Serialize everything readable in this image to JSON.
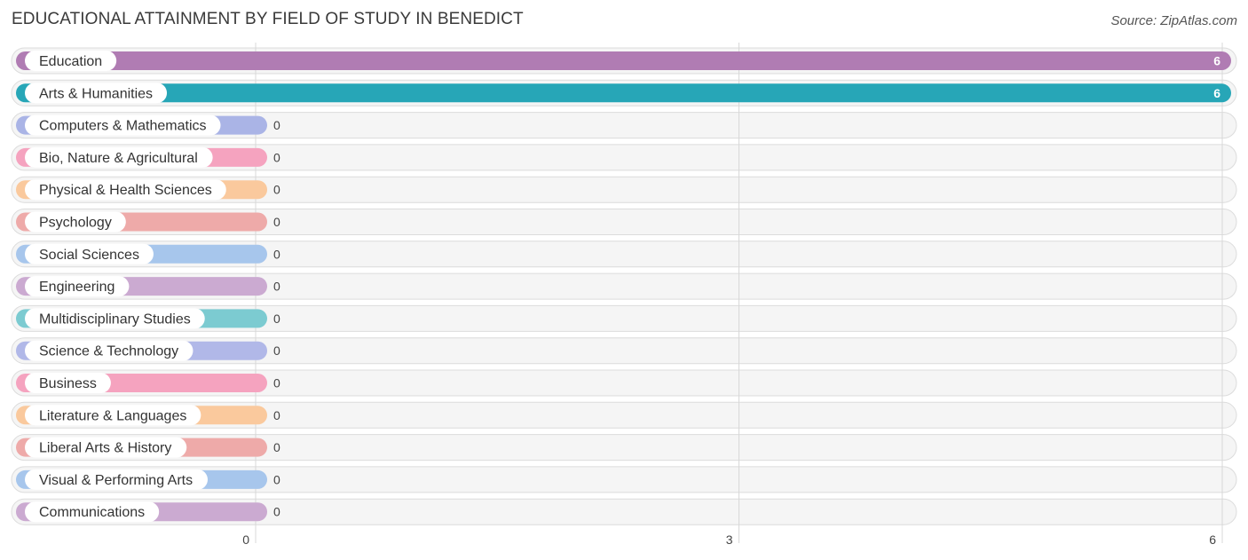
{
  "chart_data": {
    "type": "bar",
    "orientation": "horizontal",
    "title": "EDUCATIONAL ATTAINMENT BY FIELD OF STUDY IN BENEDICT",
    "source": "Source: ZipAtlas.com",
    "xlabel": "",
    "ylabel": "",
    "xlim": [
      0,
      6
    ],
    "xticks": [
      0,
      3,
      6
    ],
    "grid": true,
    "categories": [
      "Education",
      "Arts & Humanities",
      "Computers & Mathematics",
      "Bio, Nature & Agricultural",
      "Physical & Health Sciences",
      "Psychology",
      "Social Sciences",
      "Engineering",
      "Multidisciplinary Studies",
      "Science & Technology",
      "Business",
      "Literature & Languages",
      "Liberal Arts & History",
      "Visual & Performing Arts",
      "Communications"
    ],
    "values": [
      6,
      6,
      0,
      0,
      0,
      0,
      0,
      0,
      0,
      0,
      0,
      0,
      0,
      0,
      0
    ],
    "colors": [
      "#b07cb3",
      "#27a6b7",
      "#aab4e6",
      "#f5a3bf",
      "#fac99d",
      "#eeaaa9",
      "#a7c6ec",
      "#cbaad1",
      "#7ccbd1",
      "#b1b8e8",
      "#f5a3bf",
      "#fac99d",
      "#eeaaa9",
      "#a7c6ec",
      "#cbaad1"
    ]
  }
}
